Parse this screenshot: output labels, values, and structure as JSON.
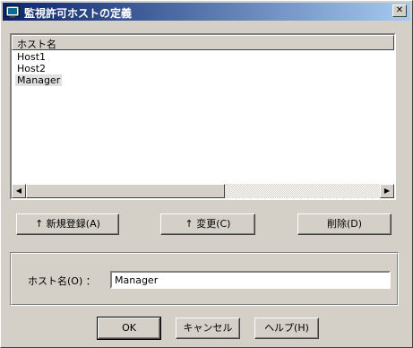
{
  "window": {
    "title": "監視許可ホストの定義",
    "close_glyph": "✕"
  },
  "list": {
    "column_header": "ホスト名",
    "items": [
      "Host1",
      "Host2",
      "Manager"
    ],
    "selected_item": "Manager",
    "scroll_left_glyph": "◀",
    "scroll_right_glyph": "▶"
  },
  "buttons": {
    "register": "↑ 新規登録(A)",
    "change": "↑ 変更(C)",
    "delete": "削除(D)",
    "ok": "OK",
    "cancel": "キャンセル",
    "help": "ヘルプ(H)"
  },
  "host_field": {
    "label": "ホスト名(O) ：",
    "value": "Manager"
  },
  "colors": {
    "titlebar_start": "#0a246a",
    "titlebar_end": "#a6caf0",
    "face": "#d4d0c8"
  }
}
